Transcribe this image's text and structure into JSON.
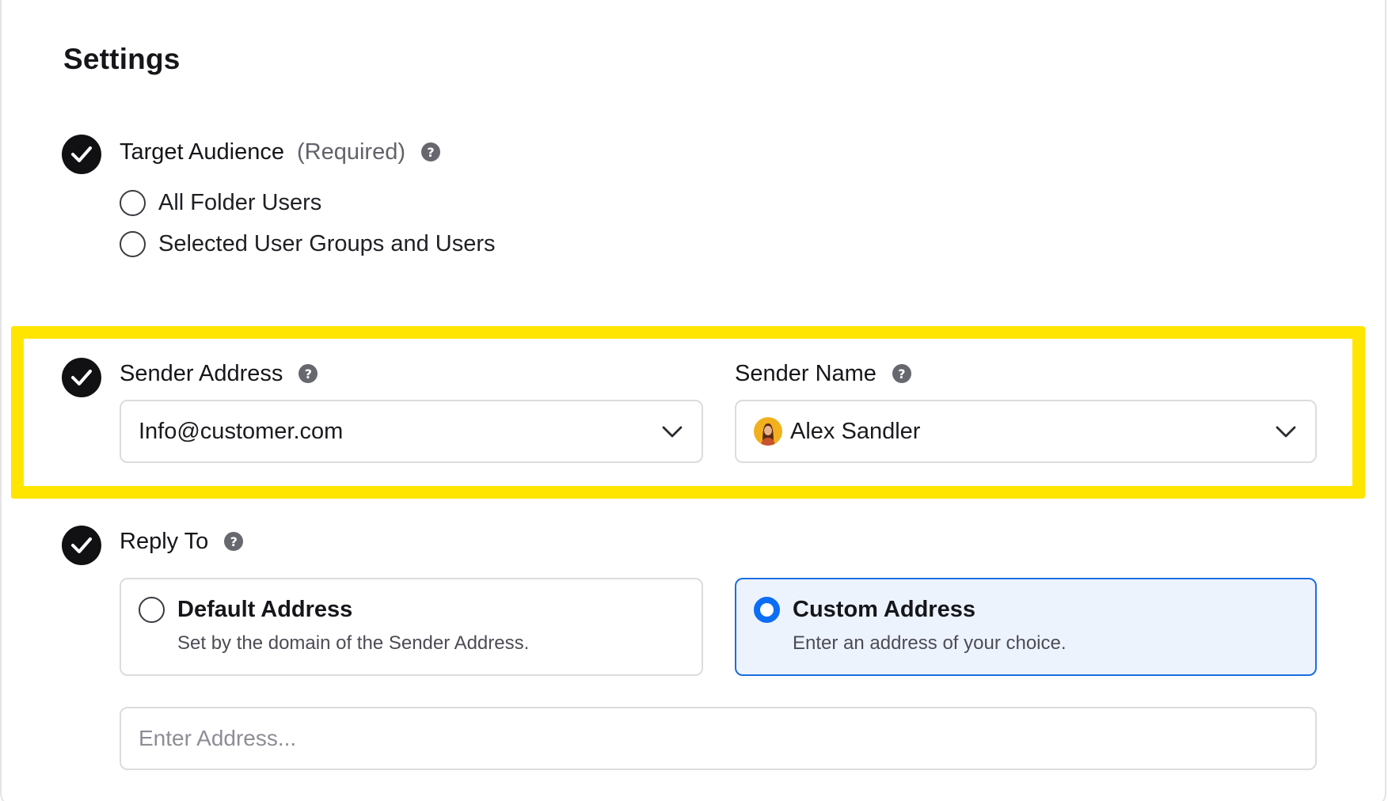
{
  "page": {
    "title": "Settings"
  },
  "target_audience": {
    "title": "Target Audience",
    "required_label": "(Required)",
    "help": "?",
    "options": [
      {
        "label": "All Folder Users",
        "selected": false
      },
      {
        "label": "Selected User Groups and Users",
        "selected": false
      }
    ]
  },
  "sender": {
    "address_label": "Sender Address",
    "address_help": "?",
    "address_value": "Info@customer.com",
    "name_label": "Sender Name",
    "name_help": "?",
    "name_value": "Alex Sandler"
  },
  "reply_to": {
    "title": "Reply To",
    "help": "?",
    "options": [
      {
        "title": "Default Address",
        "description": "Set by the domain of the Sender Address.",
        "selected": false
      },
      {
        "title": "Custom Address",
        "description": "Enter an address of your choice.",
        "selected": true
      }
    ],
    "input_placeholder": "Enter Address...",
    "input_value": ""
  },
  "colors": {
    "highlight": "#ffe500",
    "accent": "#0b6ef5",
    "check_bg": "#111114",
    "selected_card_bg": "#edf3fd"
  },
  "icons": {
    "check": "check-icon",
    "help": "help-icon",
    "chevron": "chevron-down-icon",
    "avatar": "avatar"
  }
}
